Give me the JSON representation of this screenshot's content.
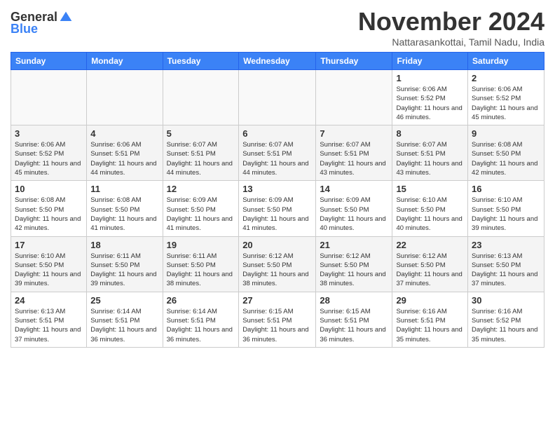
{
  "header": {
    "logo_general": "General",
    "logo_blue": "Blue",
    "month_title": "November 2024",
    "location": "Nattarasankottai, Tamil Nadu, India"
  },
  "weekdays": [
    "Sunday",
    "Monday",
    "Tuesday",
    "Wednesday",
    "Thursday",
    "Friday",
    "Saturday"
  ],
  "weeks": [
    [
      {
        "day": "",
        "info": ""
      },
      {
        "day": "",
        "info": ""
      },
      {
        "day": "",
        "info": ""
      },
      {
        "day": "",
        "info": ""
      },
      {
        "day": "",
        "info": ""
      },
      {
        "day": "1",
        "info": "Sunrise: 6:06 AM\nSunset: 5:52 PM\nDaylight: 11 hours and 46 minutes."
      },
      {
        "day": "2",
        "info": "Sunrise: 6:06 AM\nSunset: 5:52 PM\nDaylight: 11 hours and 45 minutes."
      }
    ],
    [
      {
        "day": "3",
        "info": "Sunrise: 6:06 AM\nSunset: 5:52 PM\nDaylight: 11 hours and 45 minutes."
      },
      {
        "day": "4",
        "info": "Sunrise: 6:06 AM\nSunset: 5:51 PM\nDaylight: 11 hours and 44 minutes."
      },
      {
        "day": "5",
        "info": "Sunrise: 6:07 AM\nSunset: 5:51 PM\nDaylight: 11 hours and 44 minutes."
      },
      {
        "day": "6",
        "info": "Sunrise: 6:07 AM\nSunset: 5:51 PM\nDaylight: 11 hours and 44 minutes."
      },
      {
        "day": "7",
        "info": "Sunrise: 6:07 AM\nSunset: 5:51 PM\nDaylight: 11 hours and 43 minutes."
      },
      {
        "day": "8",
        "info": "Sunrise: 6:07 AM\nSunset: 5:51 PM\nDaylight: 11 hours and 43 minutes."
      },
      {
        "day": "9",
        "info": "Sunrise: 6:08 AM\nSunset: 5:50 PM\nDaylight: 11 hours and 42 minutes."
      }
    ],
    [
      {
        "day": "10",
        "info": "Sunrise: 6:08 AM\nSunset: 5:50 PM\nDaylight: 11 hours and 42 minutes."
      },
      {
        "day": "11",
        "info": "Sunrise: 6:08 AM\nSunset: 5:50 PM\nDaylight: 11 hours and 41 minutes."
      },
      {
        "day": "12",
        "info": "Sunrise: 6:09 AM\nSunset: 5:50 PM\nDaylight: 11 hours and 41 minutes."
      },
      {
        "day": "13",
        "info": "Sunrise: 6:09 AM\nSunset: 5:50 PM\nDaylight: 11 hours and 41 minutes."
      },
      {
        "day": "14",
        "info": "Sunrise: 6:09 AM\nSunset: 5:50 PM\nDaylight: 11 hours and 40 minutes."
      },
      {
        "day": "15",
        "info": "Sunrise: 6:10 AM\nSunset: 5:50 PM\nDaylight: 11 hours and 40 minutes."
      },
      {
        "day": "16",
        "info": "Sunrise: 6:10 AM\nSunset: 5:50 PM\nDaylight: 11 hours and 39 minutes."
      }
    ],
    [
      {
        "day": "17",
        "info": "Sunrise: 6:10 AM\nSunset: 5:50 PM\nDaylight: 11 hours and 39 minutes."
      },
      {
        "day": "18",
        "info": "Sunrise: 6:11 AM\nSunset: 5:50 PM\nDaylight: 11 hours and 39 minutes."
      },
      {
        "day": "19",
        "info": "Sunrise: 6:11 AM\nSunset: 5:50 PM\nDaylight: 11 hours and 38 minutes."
      },
      {
        "day": "20",
        "info": "Sunrise: 6:12 AM\nSunset: 5:50 PM\nDaylight: 11 hours and 38 minutes."
      },
      {
        "day": "21",
        "info": "Sunrise: 6:12 AM\nSunset: 5:50 PM\nDaylight: 11 hours and 38 minutes."
      },
      {
        "day": "22",
        "info": "Sunrise: 6:12 AM\nSunset: 5:50 PM\nDaylight: 11 hours and 37 minutes."
      },
      {
        "day": "23",
        "info": "Sunrise: 6:13 AM\nSunset: 5:50 PM\nDaylight: 11 hours and 37 minutes."
      }
    ],
    [
      {
        "day": "24",
        "info": "Sunrise: 6:13 AM\nSunset: 5:51 PM\nDaylight: 11 hours and 37 minutes."
      },
      {
        "day": "25",
        "info": "Sunrise: 6:14 AM\nSunset: 5:51 PM\nDaylight: 11 hours and 36 minutes."
      },
      {
        "day": "26",
        "info": "Sunrise: 6:14 AM\nSunset: 5:51 PM\nDaylight: 11 hours and 36 minutes."
      },
      {
        "day": "27",
        "info": "Sunrise: 6:15 AM\nSunset: 5:51 PM\nDaylight: 11 hours and 36 minutes."
      },
      {
        "day": "28",
        "info": "Sunrise: 6:15 AM\nSunset: 5:51 PM\nDaylight: 11 hours and 36 minutes."
      },
      {
        "day": "29",
        "info": "Sunrise: 6:16 AM\nSunset: 5:51 PM\nDaylight: 11 hours and 35 minutes."
      },
      {
        "day": "30",
        "info": "Sunrise: 6:16 AM\nSunset: 5:52 PM\nDaylight: 11 hours and 35 minutes."
      }
    ]
  ]
}
